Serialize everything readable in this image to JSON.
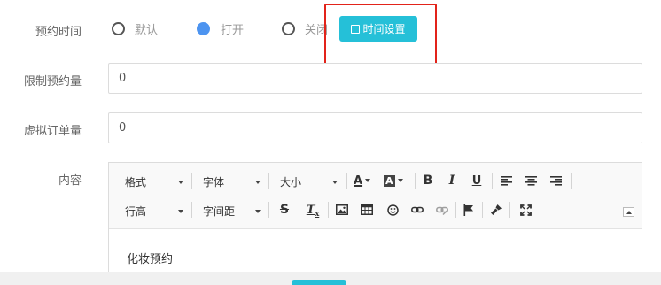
{
  "form": {
    "booking_time": {
      "label": "预约时间",
      "options": [
        {
          "label": "默认",
          "checked": false
        },
        {
          "label": "打开",
          "checked": true
        },
        {
          "label": "关闭",
          "checked": false
        }
      ],
      "time_button_label": "时间设置",
      "time_button_icon": "calendar-icon"
    },
    "limit_quantity": {
      "label": "限制预约量",
      "value": "0"
    },
    "virtual_orders": {
      "label": "虚拟订单量",
      "value": "0"
    },
    "content": {
      "label": "内容",
      "editor_text": "化妆预约",
      "toolbar": {
        "format": "格式",
        "font": "字体",
        "size": "大小",
        "line_height": "行高",
        "letter_spacing": "字间距"
      }
    }
  },
  "colors": {
    "accent": "#25c0d8",
    "radio_checked": "#4d94f0",
    "highlight": "#e2231a"
  }
}
